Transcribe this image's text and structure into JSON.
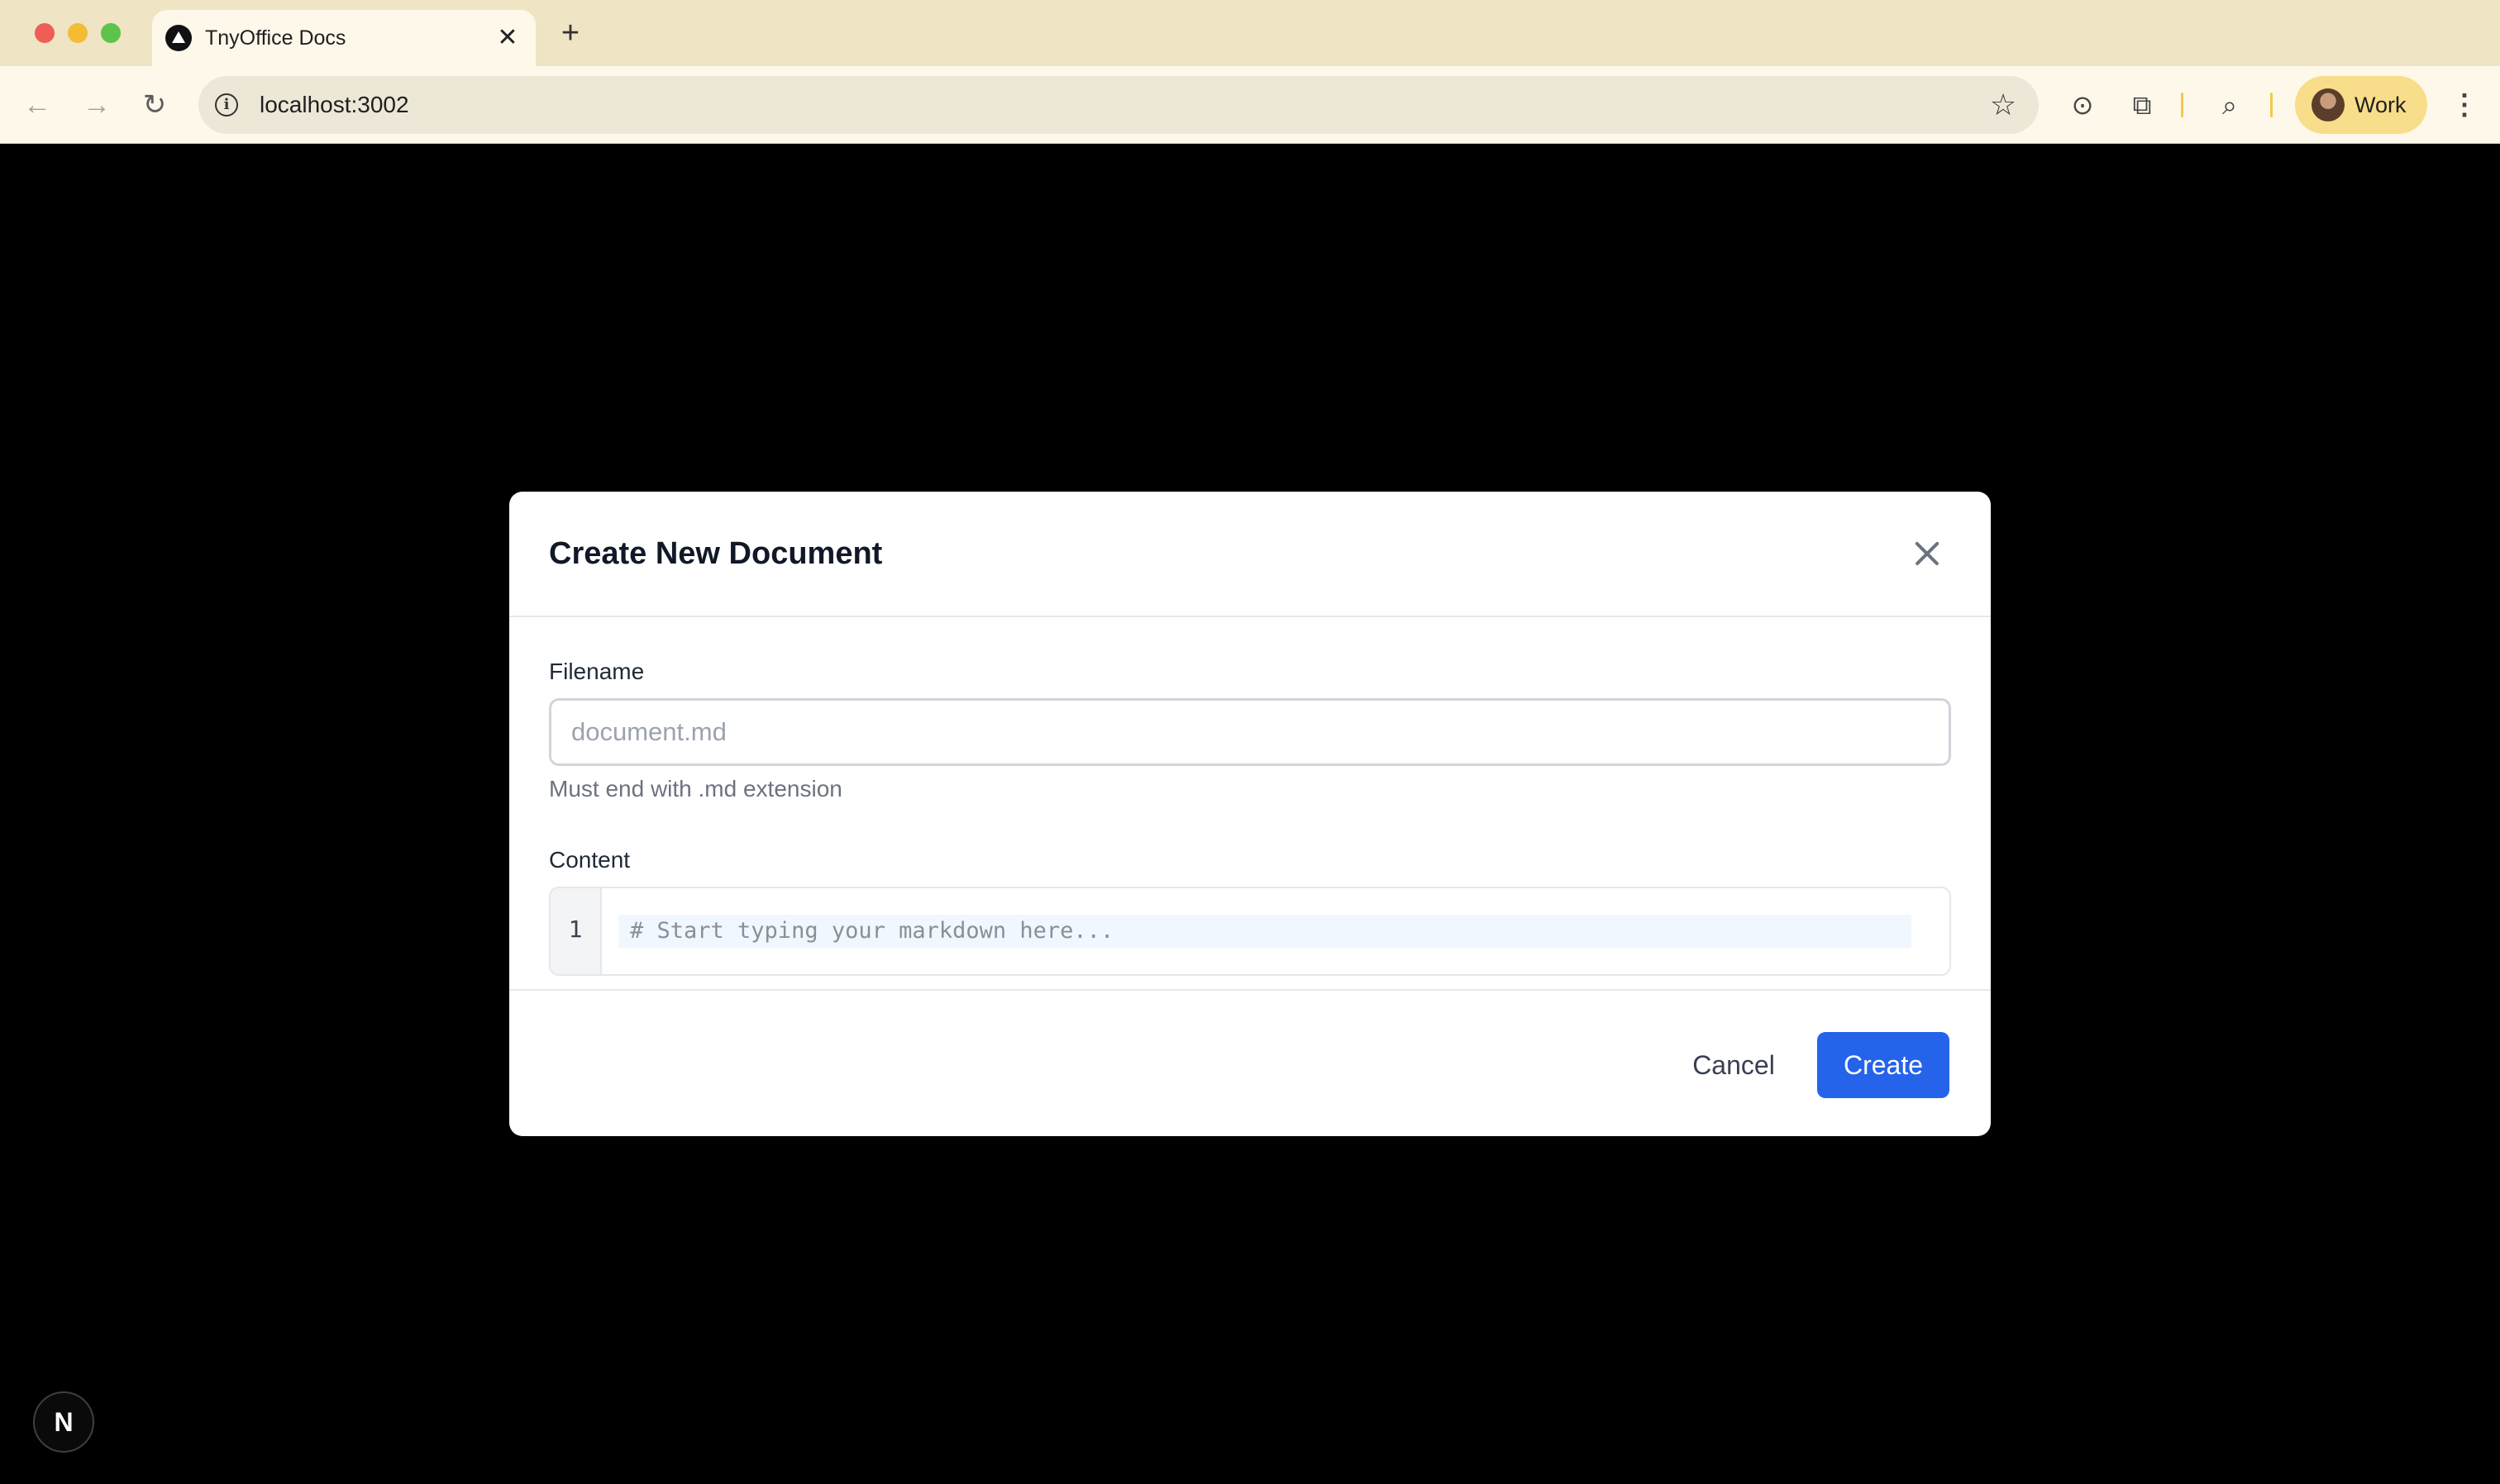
{
  "browser": {
    "tab": {
      "title": "TnyOffice Docs",
      "close_glyph": "✕"
    },
    "new_tab_glyph": "+",
    "url": "localhost:3002",
    "profile_label": "Work",
    "icons": {
      "back": "arrow-left-icon",
      "forward": "arrow-right-icon",
      "reload": "reload-icon",
      "info": "info-icon",
      "bookmark": "star-icon",
      "password": "password-manager-icon",
      "extensions": "puzzle-icon",
      "lens": "search-tab-icon",
      "menu": "kebab-menu-icon"
    },
    "glyphs": {
      "back": "←",
      "forward": "→",
      "reload": "↻",
      "info": "i",
      "star": "☆",
      "ext": "⧉",
      "lens": "⌕",
      "menu": "⋮",
      "pw": "⊙"
    }
  },
  "modal": {
    "title": "Create New Document",
    "filename": {
      "label": "Filename",
      "placeholder": "document.md",
      "value": "",
      "hint": "Must end with .md extension"
    },
    "content": {
      "label": "Content",
      "line_number": "1",
      "placeholder": "# Start typing your markdown here..."
    },
    "cancel_label": "Cancel",
    "create_label": "Create"
  },
  "dev_indicator": {
    "label": "N"
  },
  "colors": {
    "tabbar": "#efe4c3",
    "toolbar": "#fdf8ea",
    "primary": "#2563eb",
    "backdrop": "#000000"
  }
}
